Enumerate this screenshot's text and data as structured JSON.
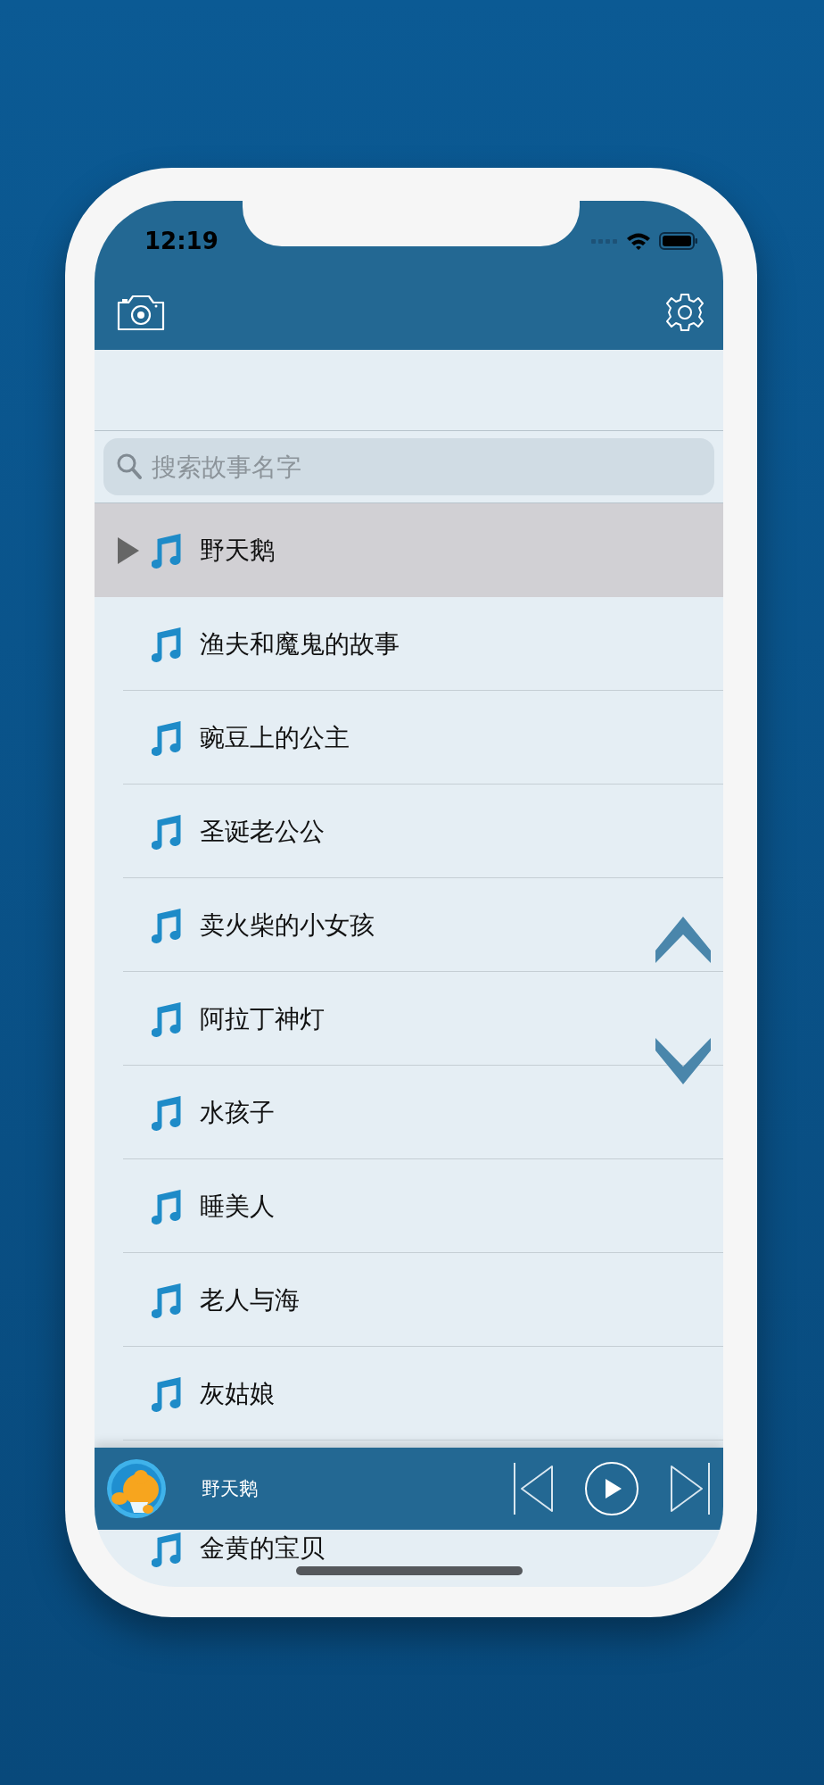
{
  "status_bar": {
    "time": "12:19"
  },
  "search": {
    "placeholder": "搜索故事名字"
  },
  "stories": [
    {
      "title": "野天鹅",
      "selected": true
    },
    {
      "title": "渔夫和魔鬼的故事",
      "selected": false
    },
    {
      "title": "豌豆上的公主",
      "selected": false
    },
    {
      "title": "圣诞老公公",
      "selected": false
    },
    {
      "title": "卖火柴的小女孩",
      "selected": false
    },
    {
      "title": "阿拉丁神灯",
      "selected": false
    },
    {
      "title": "水孩子",
      "selected": false
    },
    {
      "title": "睡美人",
      "selected": false
    },
    {
      "title": "老人与海",
      "selected": false
    },
    {
      "title": "灰姑娘",
      "selected": false
    },
    {
      "title": "金黄的宝贝",
      "selected": false
    }
  ],
  "player": {
    "title": "野天鹅",
    "playing": false
  }
}
